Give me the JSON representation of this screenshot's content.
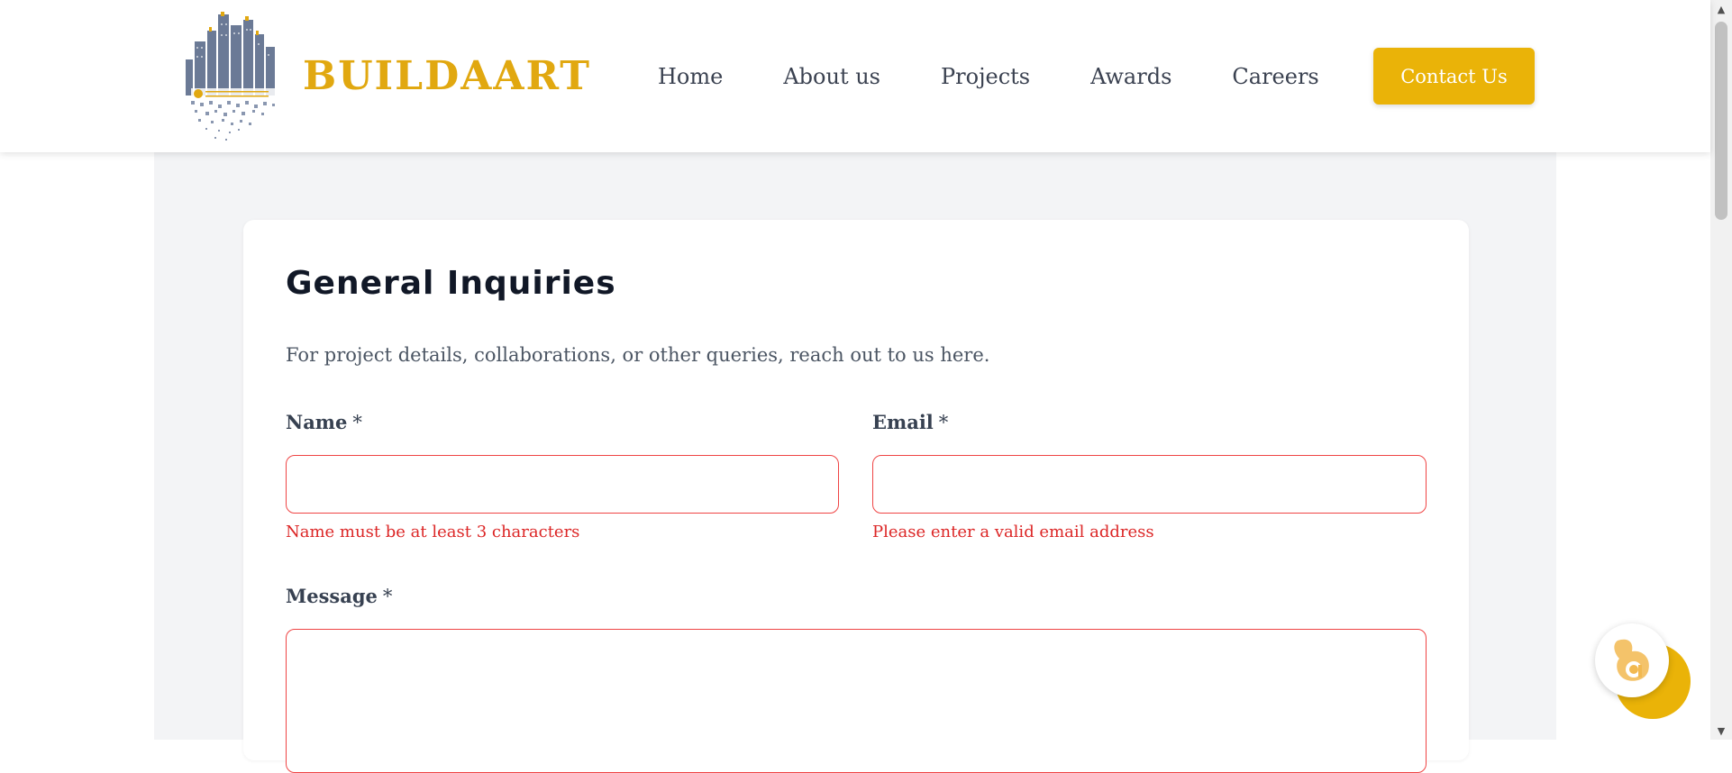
{
  "header": {
    "brand_name": "BUILDAART",
    "logo_icon": "building-skyline-logo",
    "nav": [
      {
        "label": "Home"
      },
      {
        "label": "About us"
      },
      {
        "label": "Projects"
      },
      {
        "label": "Awards"
      },
      {
        "label": "Careers"
      }
    ],
    "cta_label": "Contact Us"
  },
  "form": {
    "title": "General Inquiries",
    "description": "For project details, collaborations, or other queries, reach out to us here.",
    "name": {
      "label": "Name",
      "required_mark": "*",
      "value": "",
      "error": "Name must be at least 3 characters"
    },
    "email": {
      "label": "Email",
      "required_mark": "*",
      "value": "",
      "error": "Please enter a valid email address"
    },
    "message": {
      "label": "Message",
      "required_mark": "*",
      "value": ""
    }
  },
  "chat_widget": {
    "icon": "chat-assistant-icon"
  },
  "colors": {
    "brand_gold": "#e1a810",
    "cta": "#eab308",
    "error": "#dc2626",
    "input_border_error": "#ef4444",
    "page_bg": "#f3f4f6",
    "text_dark": "#111827",
    "nav_text": "#3a4150"
  }
}
